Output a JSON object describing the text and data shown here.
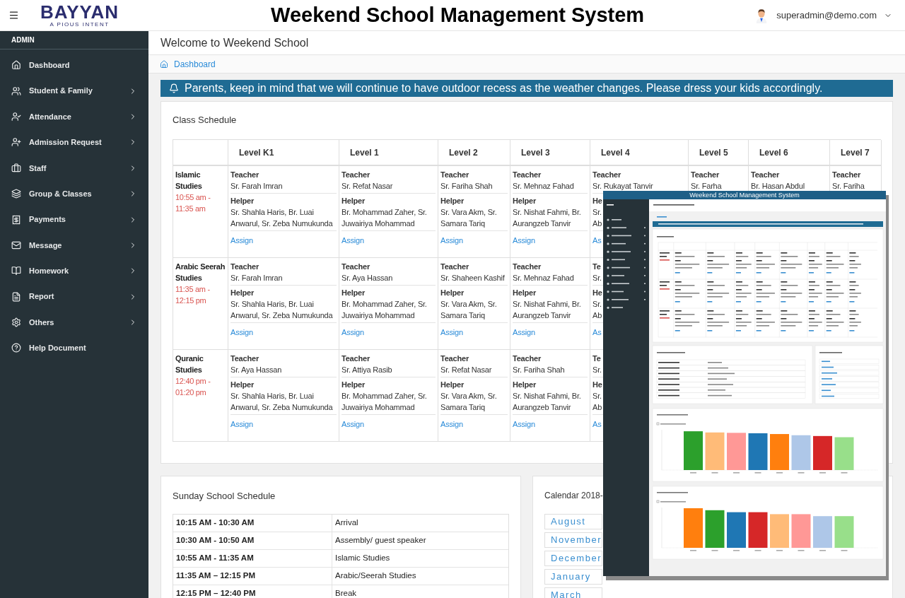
{
  "header": {
    "logo": {
      "wordmark": "BAYYAN",
      "tagline": "A PIOUS INTENT"
    },
    "title": "Weekend School Management System",
    "user": "superadmin@demo.com"
  },
  "sidebar": {
    "role": "ADMIN",
    "items": [
      {
        "label": "Dashboard",
        "expandable": false
      },
      {
        "label": "Student & Family",
        "expandable": true
      },
      {
        "label": "Attendance",
        "expandable": true
      },
      {
        "label": "Admission Request",
        "expandable": true
      },
      {
        "label": "Staff",
        "expandable": true
      },
      {
        "label": "Group & Classes",
        "expandable": true
      },
      {
        "label": "Payments",
        "expandable": true
      },
      {
        "label": "Message",
        "expandable": true
      },
      {
        "label": "Homework",
        "expandable": true
      },
      {
        "label": "Report",
        "expandable": true
      },
      {
        "label": "Others",
        "expandable": true
      },
      {
        "label": "Help Document",
        "expandable": false
      }
    ]
  },
  "page": {
    "title": "Welcome to Weekend School",
    "breadcrumb": "Dashboard",
    "notice": "Parents, keep in mind that we will continue to have outdoor recess as the weather changes. Please dress your kids accordingly."
  },
  "class_schedule": {
    "title": "Class Schedule",
    "columns": [
      "Level K1",
      "Level 1",
      "Level 2",
      "Level 3",
      "Level 4",
      "Level 5",
      "Level 6",
      "Level 7"
    ],
    "rows": [
      {
        "subject": [
          "Islamic",
          "Studies"
        ],
        "time": [
          "10:55 am -",
          "11:35 am"
        ],
        "cells": [
          {
            "teacher_label": "Teacher",
            "teacher": [
              "Sr. Farah Imran"
            ],
            "helper_label": "Helper",
            "helpers": [
              "Sr. Shahla Haris, Br. Luai",
              "Anwarul, Sr. Zeba Numukunda"
            ],
            "link": "Assign"
          },
          {
            "teacher_label": "Teacher",
            "teacher": [
              "Sr. Refat Nasar"
            ],
            "helper_label": "Helper",
            "helpers": [
              "Br. Mohammad Zaher, Sr.",
              "Juwairiya Mohammad"
            ],
            "link": "Assign"
          },
          {
            "teacher_label": "Teacher",
            "teacher": [
              "Sr. Fariha Shah"
            ],
            "helper_label": "Helper",
            "helpers": [
              "Sr. Vara Akm, Sr.",
              "Samara Tariq"
            ],
            "link": "Assign"
          },
          {
            "teacher_label": "Teacher",
            "teacher": [
              "Sr. Mehnaz Fahad"
            ],
            "helper_label": "Helper",
            "helpers": [
              "Sr. Nishat Fahmi, Br.",
              "Aurangzeb Tanvir"
            ],
            "link": "Assign"
          },
          {
            "teacher_label": "Teacher",
            "teacher": [
              "Sr. Rukayat Tanvir"
            ],
            "helper_label": "He",
            "helpers": [
              "Sr.",
              "Ab"
            ],
            "link": "As"
          },
          {
            "teacher_label": "Teacher",
            "teacher": [
              "Sr. Farha"
            ]
          },
          {
            "teacher_label": "Teacher",
            "teacher": [
              "Br. Hasan Abdul"
            ]
          },
          {
            "teacher_label": "Teacher",
            "teacher": [
              "Sr. Fariha"
            ]
          }
        ]
      },
      {
        "subject": [
          "Arabic Seerah",
          "Studies"
        ],
        "time": [
          "11:35 am -",
          "12:15 pm"
        ],
        "cells": [
          {
            "teacher_label": "Teacher",
            "teacher": [
              "Sr. Farah Imran"
            ],
            "helper_label": "Helper",
            "helpers": [
              "Sr. Shahla Haris, Br. Luai",
              "Anwarul, Sr. Zeba Numukunda"
            ],
            "link": "Assign"
          },
          {
            "teacher_label": "Teacher",
            "teacher": [
              "Sr. Aya Hassan"
            ],
            "helper_label": "Helper",
            "helpers": [
              "Br. Mohammad Zaher, Sr.",
              "Juwairiya Mohammad"
            ],
            "link": "Assign"
          },
          {
            "teacher_label": "Teacher",
            "teacher": [
              "Sr. Shaheen Kashif"
            ],
            "helper_label": "Helper",
            "helpers": [
              "Sr. Vara Akm, Sr.",
              "Samara Tariq"
            ],
            "link": "Assign"
          },
          {
            "teacher_label": "Teacher",
            "teacher": [
              "Sr. Mehnaz Fahad"
            ],
            "helper_label": "Helper",
            "helpers": [
              "Sr. Nishat Fahmi, Br.",
              "Aurangzeb Tanvir"
            ],
            "link": "Assign"
          },
          {
            "teacher_label": "Te",
            "teacher": [
              "Sr."
            ],
            "helper_label": "He",
            "helpers": [
              "Sr.",
              "Ab"
            ],
            "link": "As"
          },
          {},
          {},
          {}
        ]
      },
      {
        "subject": [
          "Quranic",
          "Studies"
        ],
        "time": [
          "12:40 pm -",
          "01:20 pm"
        ],
        "cells": [
          {
            "teacher_label": "Teacher",
            "teacher": [
              "Sr. Aya Hassan"
            ],
            "helper_label": "Helper",
            "helpers": [
              "Sr. Shahla Haris, Br. Luai",
              "Anwarul, Sr. Zeba Numukunda"
            ],
            "link": "Assign"
          },
          {
            "teacher_label": "Teacher",
            "teacher": [
              "Sr. Attiya Rasib"
            ],
            "helper_label": "Helper",
            "helpers": [
              "Br. Mohammad Zaher, Sr.",
              "Juwairiya Mohammad"
            ],
            "link": "Assign"
          },
          {
            "teacher_label": "Teacher",
            "teacher": [
              "Sr. Refat Nasar"
            ],
            "helper_label": "Helper",
            "helpers": [
              "Sr. Vara Akm, Sr.",
              "Samara Tariq"
            ],
            "link": "Assign"
          },
          {
            "teacher_label": "Teacher",
            "teacher": [
              "Sr. Fariha Shah"
            ],
            "helper_label": "Helper",
            "helpers": [
              "Sr. Nishat Fahmi, Br.",
              "Aurangzeb Tanvir"
            ],
            "link": "Assign"
          },
          {
            "teacher_label": "Te",
            "teacher": [
              "Sr."
            ],
            "helper_label": "He",
            "helpers": [
              "Sr.",
              "Ab"
            ],
            "link": "As"
          },
          {},
          {},
          {}
        ]
      }
    ]
  },
  "sunday_schedule": {
    "title": "Sunday School Schedule",
    "rows": [
      {
        "time": "10:15 AM - 10:30 AM",
        "activity": "Arrival"
      },
      {
        "time": "10:30 AM - 10:50 AM",
        "activity": "Assembly/ guest speaker"
      },
      {
        "time": "10:55 AM - 11:35 AM",
        "activity": "Islamic Studies"
      },
      {
        "time": "11:35 AM – 12:15 PM",
        "activity": "Arabic/Seerah Studies"
      },
      {
        "time": "12:15 PM – 12:40 PM",
        "activity": "Break"
      }
    ]
  },
  "calendar": {
    "title": "Calendar 2018-",
    "months": [
      "August",
      "November",
      "December",
      "January",
      "March"
    ]
  },
  "inset": {
    "kind": "screenshot",
    "title": "Weekend School Management System"
  }
}
